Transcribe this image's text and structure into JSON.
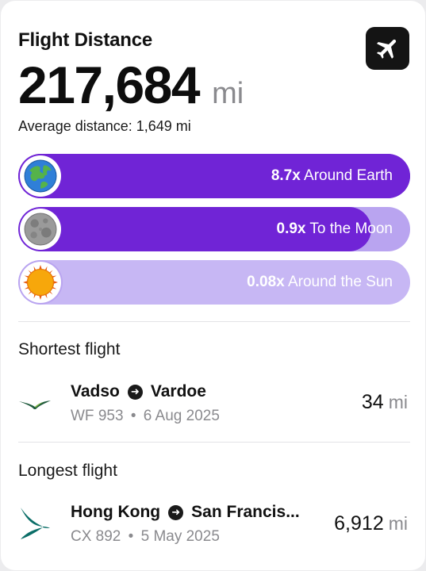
{
  "header": {
    "title": "Flight Distance",
    "total_distance": "217,684",
    "unit": "mi",
    "average_text": "Average distance: 1,649 mi",
    "app_icon": "airplane-icon"
  },
  "comparisons": [
    {
      "icon": "earth-icon",
      "multiplier": "8.7x",
      "label": "Around Earth",
      "fill_fraction": 1.0,
      "fill_color": "#7024d6",
      "track_color": "#7024d6"
    },
    {
      "icon": "moon-icon",
      "multiplier": "0.9x",
      "label": "To the Moon",
      "fill_fraction": 0.9,
      "fill_color": "#7024d6",
      "track_color": "#b9a4f0"
    },
    {
      "icon": "sun-icon",
      "multiplier": "0.08x",
      "label": "Around the Sun",
      "fill_fraction": 0.08,
      "fill_color": "#b9a4f0",
      "track_color": "#c7b7f4"
    }
  ],
  "shortest": {
    "section_label": "Shortest flight",
    "from": "Vadso",
    "to": "Vardoe",
    "flight": "WF 953",
    "date": "6 Aug 2025",
    "distance": "34",
    "unit": "mi",
    "airline_icon": "wideroe-logo-icon"
  },
  "longest": {
    "section_label": "Longest flight",
    "from": "Hong Kong",
    "to": "San Francis...",
    "flight": "CX 892",
    "date": "5 May 2025",
    "distance": "6,912",
    "unit": "mi",
    "airline_icon": "cathay-logo-icon"
  },
  "separator": "•"
}
